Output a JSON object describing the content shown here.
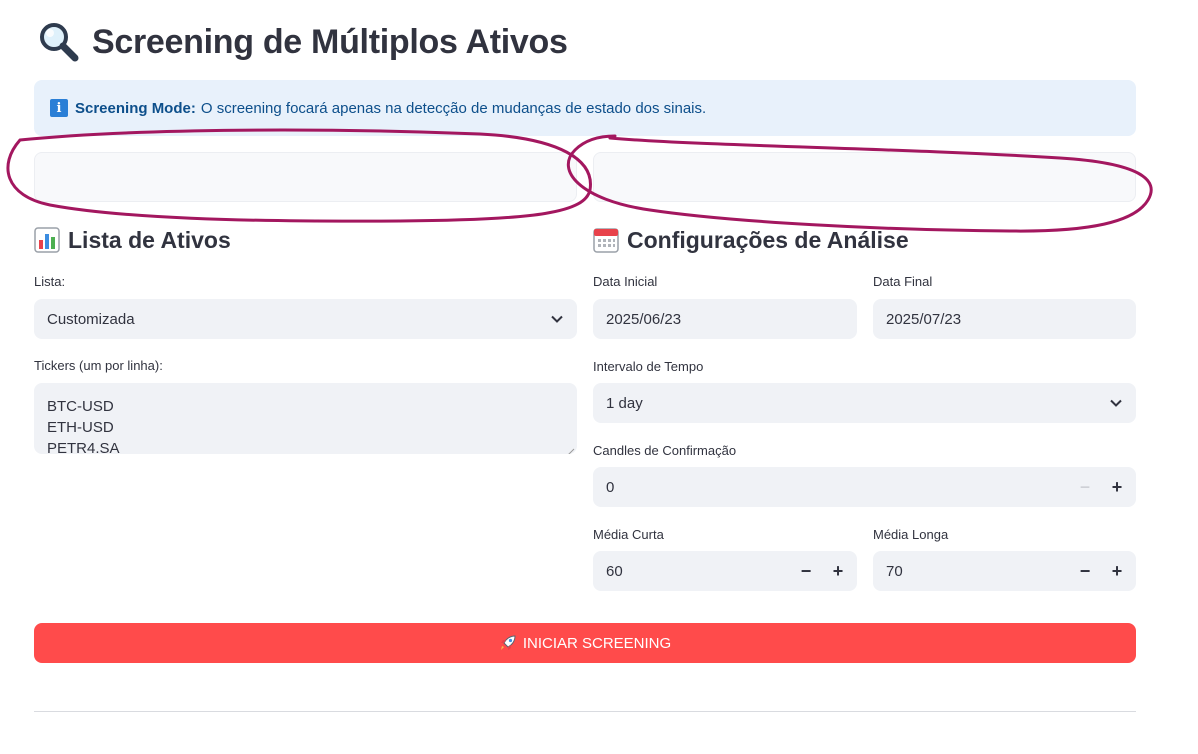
{
  "page": {
    "title": "Screening de Múltiplos Ativos",
    "title_icon": "magnifying-glass-icon"
  },
  "info_box": {
    "icon": "info-icon",
    "icon_text": "i",
    "bold": "Screening Mode:",
    "text": "O screening focará apenas na detecção de mudanças de estado dos sinais."
  },
  "left_section": {
    "icon": "bar-chart-icon",
    "title": "Lista de Ativos",
    "list_label": "Lista:",
    "list_value": "Customizada",
    "tickers_label": "Tickers (um por linha):",
    "tickers": [
      "BTC-USD",
      "ETH-USD",
      "PETR4.SA"
    ]
  },
  "right_section": {
    "icon": "calendar-icon",
    "title": "Configurações de Análise",
    "start_date_label": "Data Inicial",
    "start_date": "2025/06/23",
    "end_date_label": "Data Final",
    "end_date": "2025/07/23",
    "interval_label": "Intervalo de Tempo",
    "interval_value": "1 day",
    "confirm_candles_label": "Candles de Confirmação",
    "confirm_candles": "0",
    "short_ma_label": "Média Curta",
    "short_ma": "60",
    "long_ma_label": "Média Longa",
    "long_ma": "70",
    "minus": "−",
    "plus": "+"
  },
  "run_button": {
    "icon": "rocket-icon",
    "label": "INICIAR SCREENING"
  },
  "colors": {
    "accent": "#ff4b4b",
    "info_bg": "#e8f1fb",
    "info_text": "#0d4f8b",
    "annotation": "#a3175f",
    "input_bg": "#f0f2f6"
  }
}
